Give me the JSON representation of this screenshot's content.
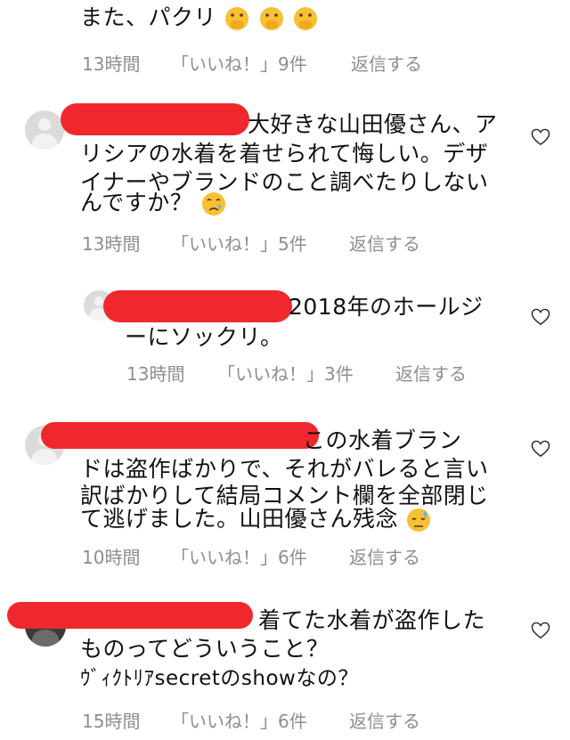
{
  "comments": [
    {
      "lines": [
        "また、パクリ"
      ],
      "emoji": [
        "hand-over-mouth-emoji",
        "hand-over-mouth-emoji",
        "hand-over-mouth-emoji"
      ],
      "meta": {
        "time": "13時間",
        "likes": "「いいね！」9件",
        "reply": "返信する"
      }
    },
    {
      "lines": [
        "大好きな山田優さん、ア",
        "リシアの水着を着せられて悔しい。デザ",
        "イナーやブランドのこと調べたりしない",
        "んですか？"
      ],
      "emoji": [
        "crying-face-emoji"
      ],
      "meta": {
        "time": "13時間",
        "likes": "「いいね！」5件",
        "reply": "返信する"
      }
    },
    {
      "lines": [
        "2018年のホールジ",
        "ーにソックリ。"
      ],
      "meta": {
        "time": "13時間",
        "likes": "「いいね！」3件",
        "reply": "返信する"
      }
    },
    {
      "lines": [
        "この水着ブラン",
        "ドは盗作ばかりで、それがバレると言い",
        "訳ばかりして結局コメント欄を全部閉じ",
        "て逃げました。山田優さん残念"
      ],
      "emoji": [
        "sweat-face-emoji"
      ],
      "meta": {
        "time": "10時間",
        "likes": "「いいね！」6件",
        "reply": "返信する"
      }
    },
    {
      "lines": [
        "着てた水着が盗作した",
        "ものってどういうこと？",
        "ｳﾞｨｸﾄﾘｱsecretのshowなの？"
      ],
      "meta": {
        "time": "15時間",
        "likes": "「いいね！」6件",
        "reply": "返信する"
      }
    }
  ],
  "colors": {
    "meta": "#8e8e8e",
    "redaction": "#f0282d",
    "avatar": "#dbdbdb"
  },
  "icons": {
    "like": "heart-outline-icon"
  }
}
